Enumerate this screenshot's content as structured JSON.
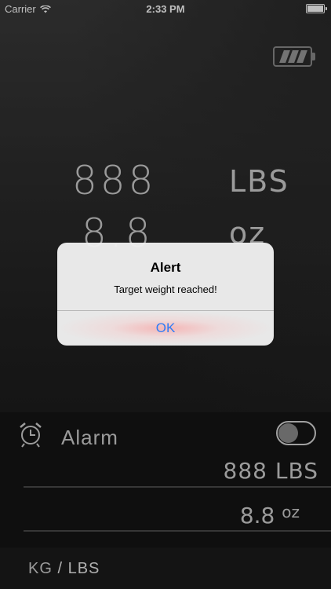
{
  "status_bar": {
    "carrier": "Carrier",
    "time": "2:33 PM",
    "icons": [
      "wifi-icon",
      "battery-icon"
    ]
  },
  "scale": {
    "battery_icon": "scale-battery-icon",
    "weight_lbs": "888",
    "weight_lbs_unit": "LBS",
    "weight_oz": "8.8",
    "weight_oz_unit": "oz"
  },
  "alert": {
    "title": "Alert",
    "message": "Target weight reached!",
    "ok_label": "OK"
  },
  "alarm": {
    "icon": "alarm-clock-icon",
    "label": "Alarm",
    "toggle_on": false,
    "target_lbs": "888",
    "target_lbs_unit": "LBS",
    "target_oz": "8.8",
    "target_oz_unit": "oz"
  },
  "footer": {
    "unit_kg": "KG",
    "separator": "/",
    "unit_lbs": "LBS"
  },
  "colors": {
    "accent": "#2e7cf6",
    "text": "#cfcfcf"
  }
}
